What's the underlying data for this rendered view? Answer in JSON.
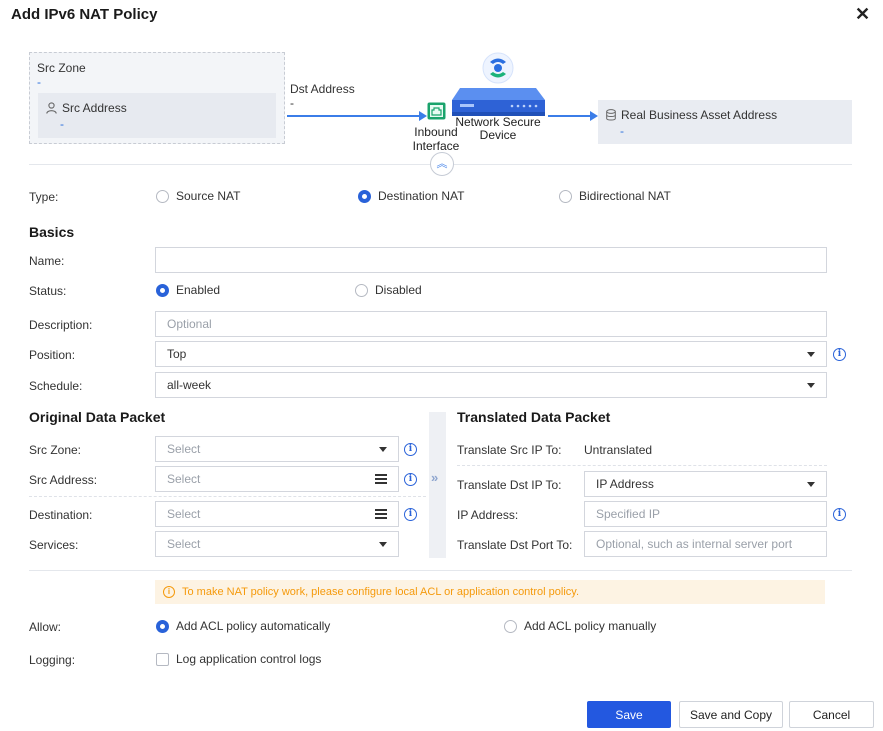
{
  "dialog": {
    "title": "Add IPv6 NAT Policy"
  },
  "diagram": {
    "src_zone_label": "Src Zone",
    "src_zone_value": "-",
    "src_address_label": "Src Address",
    "src_address_value": "-",
    "dst_address_label": "Dst Address",
    "dst_address_value": "-",
    "inbound_interface_label": "Inbound Interface",
    "device_label": "Network Secure Device",
    "real_asset_label": "Real Business Asset Address",
    "real_asset_value": "-"
  },
  "type": {
    "label": "Type:",
    "options": [
      "Source NAT",
      "Destination NAT",
      "Bidirectional NAT"
    ],
    "selected": "Destination NAT"
  },
  "basics": {
    "heading": "Basics",
    "name_label": "Name:",
    "name_value": "",
    "status_label": "Status:",
    "status_options": [
      "Enabled",
      "Disabled"
    ],
    "status_selected": "Enabled",
    "description_label": "Description:",
    "description_placeholder": "Optional",
    "position_label": "Position:",
    "position_value": "Top",
    "schedule_label": "Schedule:",
    "schedule_value": "all-week"
  },
  "original": {
    "heading": "Original Data Packet",
    "src_zone_label": "Src Zone:",
    "src_zone_placeholder": "Select",
    "src_address_label": "Src Address:",
    "src_address_placeholder": "Select",
    "destination_label": "Destination:",
    "destination_placeholder": "Select",
    "services_label": "Services:",
    "services_placeholder": "Select"
  },
  "translated": {
    "heading": "Translated Data Packet",
    "src_ip_label": "Translate Src IP To:",
    "src_ip_value": "Untranslated",
    "dst_ip_label": "Translate Dst IP To:",
    "dst_ip_value": "IP Address",
    "ip_address_label": "IP Address:",
    "ip_address_placeholder": "Specified IP",
    "dst_port_label": "Translate Dst Port To:",
    "dst_port_placeholder": "Optional, such as internal server port"
  },
  "warning": {
    "text": "To make NAT policy work, please configure local ACL or application control policy."
  },
  "allow": {
    "label": "Allow:",
    "options": [
      "Add ACL policy automatically",
      "Add ACL policy manually"
    ],
    "selected": "Add ACL policy automatically"
  },
  "logging": {
    "label": "Logging:",
    "checkbox_label": "Log application control logs",
    "checked": false
  },
  "footer": {
    "save_label": "Save",
    "save_copy_label": "Save and Copy",
    "cancel_label": "Cancel"
  },
  "colors": {
    "primary": "#2358e0",
    "warning": "#f59a0c",
    "accent_line": "#3b7de8"
  }
}
